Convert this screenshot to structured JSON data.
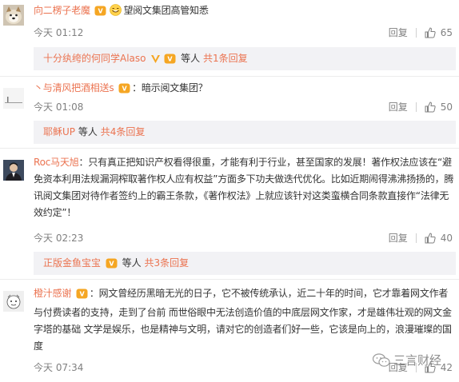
{
  "comments": [
    {
      "username": "向二楞子老魔",
      "text": "望阅文集团高管知悉",
      "time": "今天 01:12",
      "reply_label": "回复",
      "likes": "65",
      "avatar": "dog-photo",
      "sub": {
        "users": "十分纨绔的何同学Alaso",
        "mid": "等人",
        "link": "共1条回复"
      }
    },
    {
      "username": "丶与清风把酒相送s",
      "text": "：暗示阅文集团？",
      "time": "今天 01:08",
      "reply_label": "回复",
      "likes": "50",
      "avatar": "default-avatar",
      "sub": {
        "users": "耶稣UP",
        "mid": "等人",
        "link": "共4条回复"
      }
    },
    {
      "username": "Roc马天旭",
      "text": "：只有真正把知识产权看得很重，才能有利于行业，甚至国家的发展！著作权法应该在“避免资本利用法规漏洞榨取著作权人应有权益”方面多下功夫做迭代优化。比如近期闹得沸沸扬扬的，腾讯阅文集团对待作者签约上的霸王条款，《著作权法》上就应该针对这类蛮横合同条款直接作“法律无效约定”！",
      "time": "今天 02:23",
      "reply_label": "回复",
      "likes": "40",
      "avatar": "person-photo",
      "sub": {
        "users": "正版金鱼宝宝",
        "mid": "等人",
        "link": "共3条回复"
      }
    },
    {
      "username": "橙汁感谢",
      "text": "：网文曾经历黑暗无光的日子，它不被传统承认，近二十年的时间，它才靠着网文作者与付费读者的支持，走到了台前 而世俗眼中无法创造价值的中底层网文作家，才是雄伟壮观的网文金字塔的基础 文学是娱乐，也是精神与文明，请对它的创造者们好一些，它该是向上的，浪漫璀璨的国度",
      "time": "今天 07:34",
      "reply_label": "回复",
      "likes": "42",
      "avatar": "cartoon-avatar",
      "sub": null
    }
  ],
  "watermark": "三言财经",
  "colors": {
    "accent": "#eb7350",
    "muted": "#808080",
    "subbox": "#f2f2f5",
    "vip": "#f5a623"
  }
}
